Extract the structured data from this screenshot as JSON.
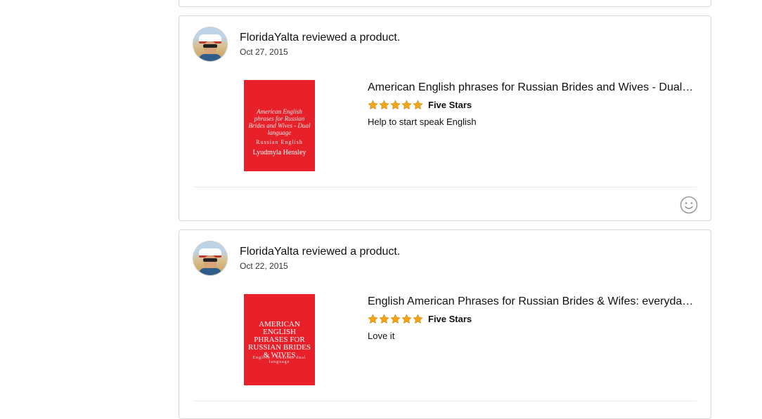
{
  "reviews": [
    {
      "reviewer": "FloridaYalta",
      "header": "FloridaYalta reviewed a product.",
      "date": "Oct 27, 2015",
      "product_title": "American English phrases for Russian Brides and Wives - Dual language",
      "rating": 5,
      "rating_title": "Five Stars",
      "review_text": "Help to start speak English",
      "cover": {
        "title": "American English phrases for Russian Brides and Wives - Dual language",
        "subtitle": "Russian English",
        "author": "Lyudmyla Hensley",
        "color": "#e8202a"
      }
    },
    {
      "reviewer": "FloridaYalta",
      "header": "FloridaYalta reviewed a product.",
      "date": "Oct 22, 2015",
      "product_title": "English American Phrases for Russian Brides & Wifes: everyday dual language",
      "rating": 5,
      "rating_title": "Five Stars",
      "review_text": "Love it",
      "cover": {
        "title": "AMERICAN ENGLISH PHRASES FOR RUSSIAN BRIDES & WIVES",
        "subtitle": "English - Russian dual language",
        "color": "#e8202a"
      }
    }
  ],
  "colors": {
    "star": "#f3a81b",
    "star_stroke": "#c77e05",
    "border": "#d6d6d6"
  },
  "icons": {
    "reaction": "smiley-icon",
    "star": "star-icon"
  }
}
